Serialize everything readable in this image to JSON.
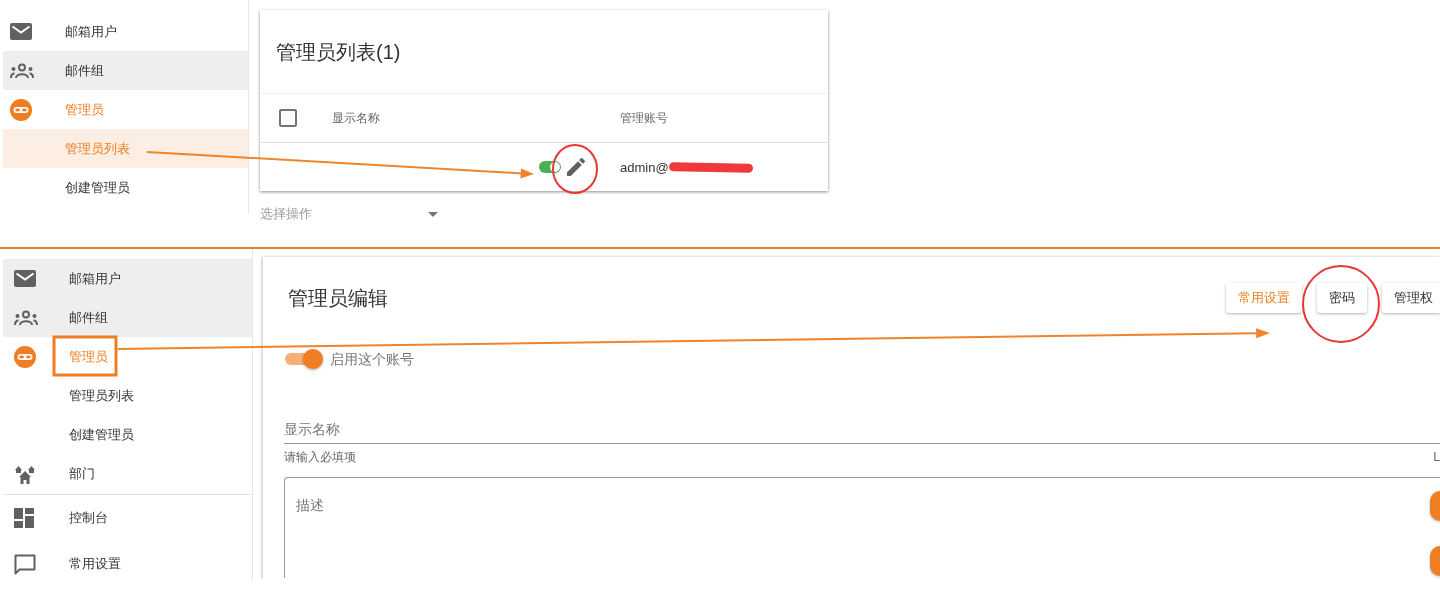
{
  "top_screen": {
    "sidebar": {
      "sections": [
        {
          "items": [
            {
              "kind": "mail",
              "label": "邮箱用户",
              "selected": false,
              "active": false,
              "highlighted": false
            },
            {
              "kind": "group",
              "label": "邮件组",
              "selected": false,
              "active": false,
              "highlighted": true
            },
            {
              "kind": "admin",
              "label": "管理员",
              "selected": false,
              "active": true,
              "highlighted": false
            },
            {
              "kind": "sub",
              "label": "管理员列表",
              "selected": true,
              "active": false,
              "highlighted": false
            },
            {
              "kind": "sub",
              "label": "创建管理员",
              "selected": false,
              "active": false,
              "highlighted": false
            }
          ]
        }
      ]
    },
    "admin_list": {
      "title": "管理员列表(1)",
      "select_all": {
        "checked": false
      },
      "columns": [
        "显示名称",
        "管理账号"
      ],
      "rows": [
        {
          "enabled": true,
          "account": "admin@"
        }
      ],
      "bulk_action": {
        "placeholder": "选择操作"
      }
    }
  },
  "bottom_screen": {
    "sidebar": {
      "sections": [
        {
          "items": [
            {
              "kind": "mail",
              "label": "邮箱用户",
              "selected": false,
              "active": false,
              "highlighted": true
            },
            {
              "kind": "group",
              "label": "邮件组",
              "selected": false,
              "active": false,
              "highlighted": true
            },
            {
              "kind": "admin",
              "label": "管理员",
              "selected": false,
              "active": true,
              "highlighted": false
            },
            {
              "kind": "sub",
              "label": "管理员列表",
              "selected": false,
              "active": false,
              "highlighted": false
            },
            {
              "kind": "sub",
              "label": "创建管理员",
              "selected": false,
              "active": false,
              "highlighted": false
            },
            {
              "kind": "department",
              "label": "部门",
              "selected": false,
              "active": false,
              "highlighted": false
            }
          ]
        },
        {
          "items": [
            {
              "kind": "dashboard",
              "label": "控制台",
              "selected": false,
              "active": false,
              "highlighted": false
            },
            {
              "kind": "settings",
              "label": "常用设置",
              "selected": false,
              "active": false,
              "highlighted": false
            }
          ]
        }
      ]
    },
    "admin_edit": {
      "title": "管理员编辑",
      "tabs": [
        {
          "label": "常用设置",
          "selected": true
        },
        {
          "label": "密码",
          "selected": false
        },
        {
          "label": "管理权",
          "selected": false
        }
      ],
      "enable_switch": {
        "label": "启用这个账号",
        "on": true
      },
      "display_name": {
        "placeholder": "显示名称",
        "helper": "请输入必填项",
        "trailing_text": "L"
      },
      "description": {
        "placeholder": "描述"
      }
    }
  }
}
